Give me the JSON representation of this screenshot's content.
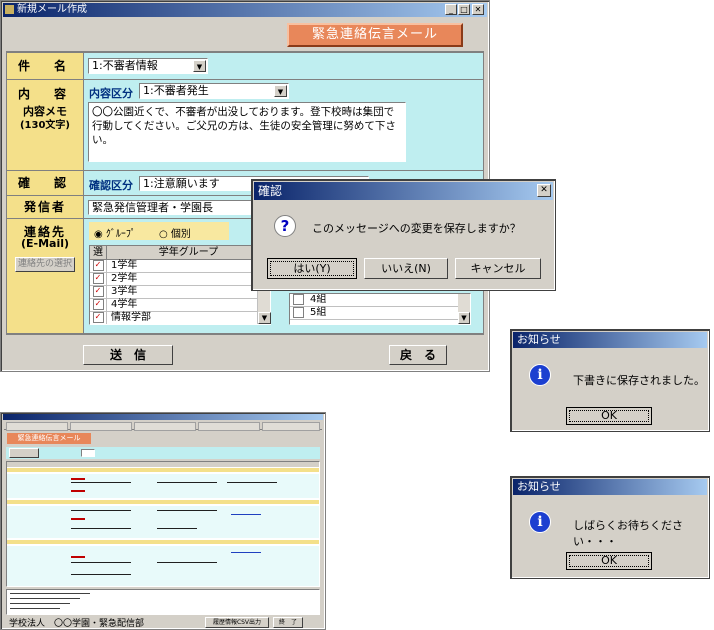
{
  "main_window": {
    "title": "新規メール作成",
    "banner": "緊急連絡伝言メール",
    "labels": {
      "subject": "件　名",
      "content": "内　容",
      "memo": "内容メモ",
      "memo_limit": "(130文字)",
      "confirm": "確　認",
      "sender": "発信者",
      "recipient": "連絡先",
      "recipient_sub": "(E-Mail)"
    },
    "subject_value": "1:不審者情報",
    "content_type_label": "内容区分",
    "content_type_value": "1:不審者発生",
    "memo_text": "〇〇公園近くで、不審者が出没しております。登下校時は集団で行動してください。ご父兄の方は、生徒の安全管理に努めて下さい。",
    "confirm_type_label": "確認区分",
    "confirm_type_value": "1:注意願います",
    "sender_value": "緊急発信管理者・学園長",
    "radio_group": "ｸﾞﾙｰﾌﾟ",
    "radio_individual": "個別",
    "select_recipient_button": "連絡先の選択",
    "grid_col_select": "選",
    "grid_col_group": "学年グループ",
    "grade_groups": [
      "1学年",
      "2学年",
      "3学年",
      "4学年",
      "情報学部"
    ],
    "class_rows": [
      "4組",
      "5組"
    ],
    "send_button": "送　信",
    "back_button": "戻　る"
  },
  "confirm_dialog": {
    "title": "確認",
    "message": "このメッセージへの変更を保存しますか？",
    "yes": "はい(Y)",
    "no": "いいえ(N)",
    "cancel": "キャンセル"
  },
  "notice1": {
    "title": "お知らせ",
    "message": "下書きに保存されました。",
    "ok": "OK"
  },
  "notice2": {
    "title": "お知らせ",
    "message": "しばらくお待ちください・・・",
    "ok": "OK"
  },
  "thumbnail": {
    "banner": "緊急連絡伝言メール",
    "footer_left": "学校法人　〇〇学園・緊急配信部",
    "csv_button": "履歴情報CSV出力",
    "end_button": "終　了"
  }
}
